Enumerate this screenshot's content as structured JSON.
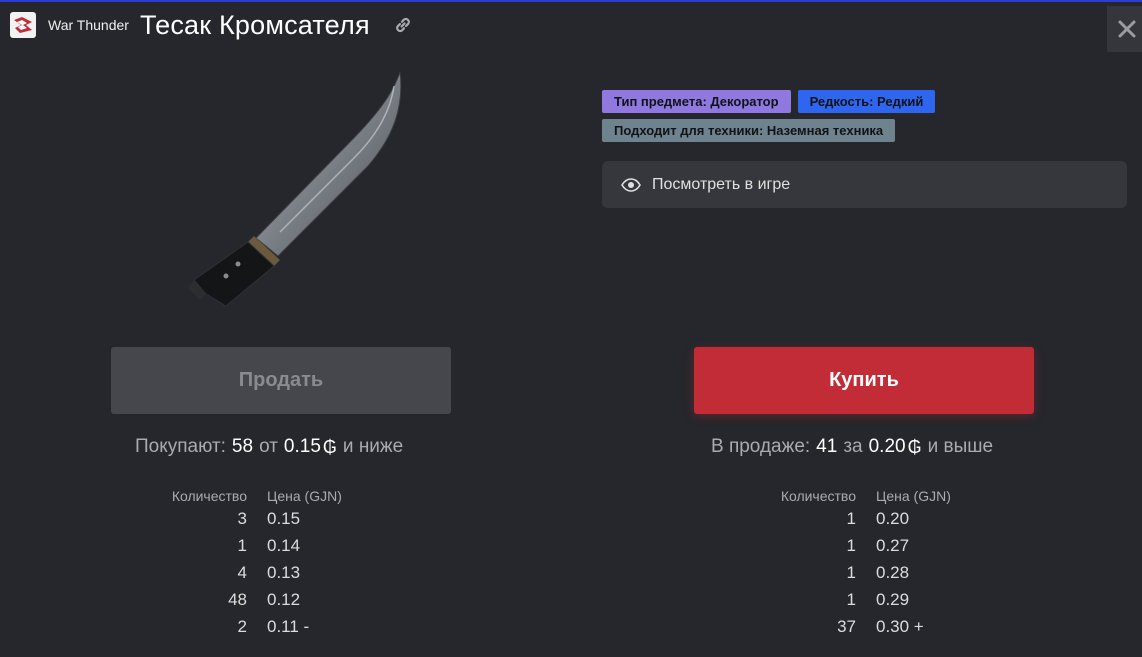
{
  "header": {
    "app_name": "War Thunder",
    "title": "Тесак Кромсателя",
    "link_icon": "link-icon",
    "close_icon": "close-icon"
  },
  "tags": {
    "type": "Тип предмета: Декоратор",
    "rarity": "Редкость: Редкий",
    "vehicle": "Подходит для техники: Наземная техника"
  },
  "view_in_game": {
    "icon": "eye-icon",
    "label": "Посмотреть в игре"
  },
  "actions": {
    "sell": "Продать",
    "buy": "Купить"
  },
  "buy_orders": {
    "label": "Покупают:",
    "count": "58",
    "from_label": "от",
    "price": "0.15",
    "coin": "₲",
    "suffix": "и ниже",
    "columns": {
      "qty": "Количество",
      "price": "Цена (GJN)"
    },
    "rows": [
      {
        "qty": "3",
        "price": "0.15"
      },
      {
        "qty": "1",
        "price": "0.14"
      },
      {
        "qty": "4",
        "price": "0.13"
      },
      {
        "qty": "48",
        "price": "0.12"
      },
      {
        "qty": "2",
        "price": "0.11 -"
      }
    ]
  },
  "sell_orders": {
    "label": "В продаже:",
    "count": "41",
    "from_label": "за",
    "price": "0.20",
    "coin": "₲",
    "suffix": "и выше",
    "columns": {
      "qty": "Количество",
      "price": "Цена (GJN)"
    },
    "rows": [
      {
        "qty": "1",
        "price": "0.20"
      },
      {
        "qty": "1",
        "price": "0.27"
      },
      {
        "qty": "1",
        "price": "0.28"
      },
      {
        "qty": "1",
        "price": "0.29"
      },
      {
        "qty": "37",
        "price": "0.30 +"
      }
    ]
  },
  "colors": {
    "background": "#25272c",
    "buy_button": "#c22c36",
    "sell_button": "#45474c",
    "tag_type": "#8f79e0",
    "tag_rarity": "#2f66f0",
    "tag_vehicle": "#6e838d"
  }
}
